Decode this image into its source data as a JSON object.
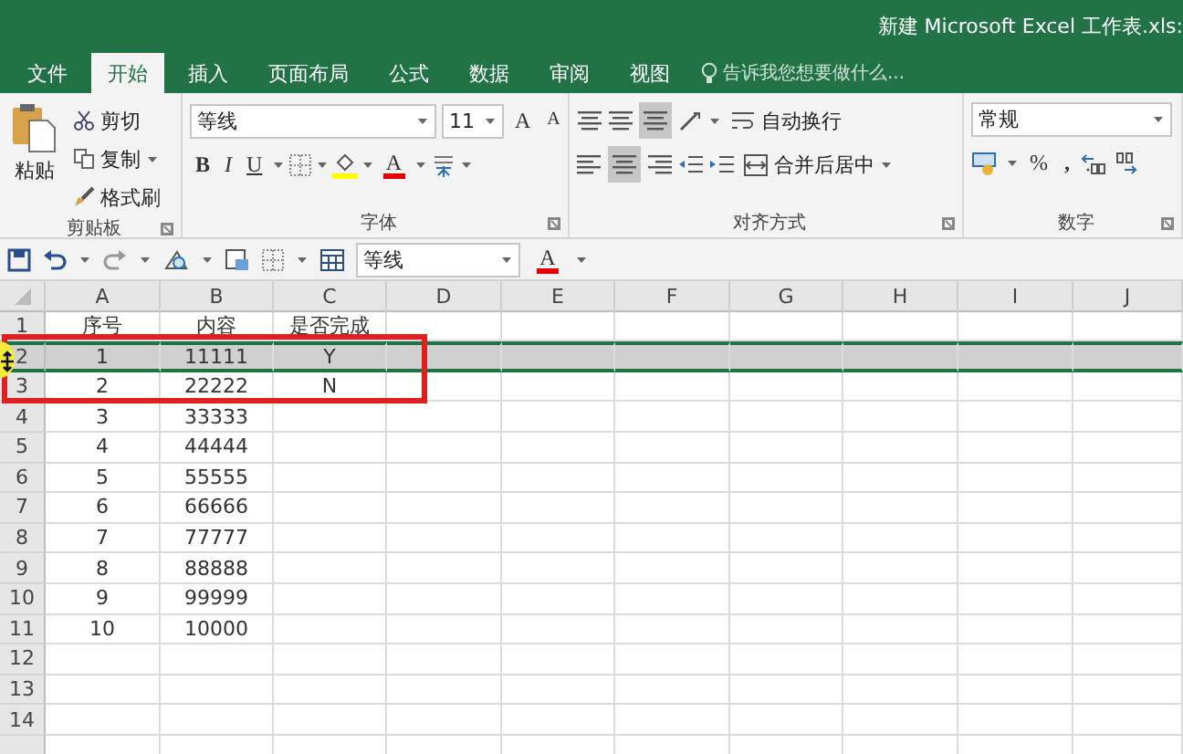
{
  "window": {
    "title": "新建 Microsoft Excel 工作表.xls:"
  },
  "tabs": [
    {
      "label": "文件",
      "selected": false
    },
    {
      "label": "开始",
      "selected": true
    },
    {
      "label": "插入",
      "selected": false
    },
    {
      "label": "页面布局",
      "selected": false
    },
    {
      "label": "公式",
      "selected": false
    },
    {
      "label": "数据",
      "selected": false
    },
    {
      "label": "审阅",
      "selected": false
    },
    {
      "label": "视图",
      "selected": false
    }
  ],
  "tell_me": {
    "placeholder": "告诉我您想要做什么..."
  },
  "ribbon": {
    "clipboard": {
      "paste": "粘贴",
      "cut": "剪切",
      "copy": "复制",
      "format_painter": "格式刷",
      "label": "剪贴板"
    },
    "font": {
      "font_name": "等线",
      "font_size": "11",
      "grow": "A",
      "shrink": "A",
      "bold": "B",
      "italic": "I",
      "underline": "U",
      "font_color": "A",
      "label": "字体"
    },
    "alignment": {
      "wrap_text": "自动换行",
      "merge_center": "合并后居中",
      "label": "对齐方式"
    },
    "number": {
      "format": "常规",
      "percent": "%",
      "comma": ",",
      "label": "数字"
    }
  },
  "quick_access": {
    "font_name": "等线",
    "font_color": "A"
  },
  "columns": [
    "A",
    "B",
    "C",
    "D",
    "E",
    "F",
    "G",
    "H",
    "I",
    "J"
  ],
  "rows": [
    {
      "header": "1",
      "selected": false,
      "cells": [
        "序号",
        "内容",
        "是否完成"
      ]
    },
    {
      "header": "2",
      "selected": true,
      "cells": [
        "1",
        "11111",
        "Y"
      ]
    },
    {
      "header": "3",
      "selected": false,
      "cells": [
        "2",
        "22222",
        "N"
      ]
    },
    {
      "header": "4",
      "selected": false,
      "cells": [
        "3",
        "33333"
      ]
    },
    {
      "header": "5",
      "selected": false,
      "cells": [
        "4",
        "44444"
      ]
    },
    {
      "header": "6",
      "selected": false,
      "cells": [
        "5",
        "55555"
      ]
    },
    {
      "header": "7",
      "selected": false,
      "cells": [
        "6",
        "66666"
      ]
    },
    {
      "header": "8",
      "selected": false,
      "cells": [
        "7",
        "77777"
      ]
    },
    {
      "header": "9",
      "selected": false,
      "cells": [
        "8",
        "88888"
      ]
    },
    {
      "header": "10",
      "selected": false,
      "cells": [
        "9",
        "99999"
      ]
    },
    {
      "header": "11",
      "selected": false,
      "cells": [
        "10",
        "10000"
      ]
    },
    {
      "header": "12",
      "selected": false
    },
    {
      "header": "13",
      "selected": false
    },
    {
      "header": "14",
      "selected": false
    }
  ]
}
